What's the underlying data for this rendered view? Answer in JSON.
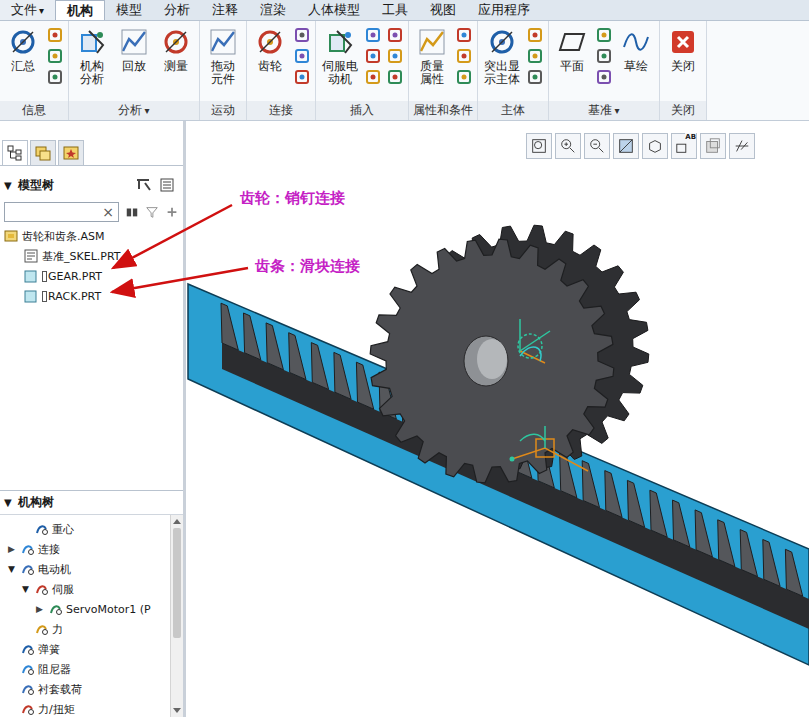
{
  "menu_bar": {
    "tabs": [
      {
        "label": "文件",
        "caret": "▾",
        "selected": false
      },
      {
        "label": "机构",
        "caret": "",
        "selected": true
      },
      {
        "label": "模型",
        "caret": "",
        "selected": false
      },
      {
        "label": "分析",
        "caret": "",
        "selected": false
      },
      {
        "label": "注释",
        "caret": "",
        "selected": false
      },
      {
        "label": "渲染",
        "caret": "",
        "selected": false
      },
      {
        "label": "人体模型",
        "caret": "",
        "selected": false
      },
      {
        "label": "工具",
        "caret": "",
        "selected": false
      },
      {
        "label": "视图",
        "caret": "",
        "selected": false
      },
      {
        "label": "应用程序",
        "caret": "",
        "selected": false
      }
    ]
  },
  "ribbon": {
    "groups": [
      {
        "label": "信息",
        "caret": "",
        "buttons": [
          {
            "lines": [
              "汇总"
            ]
          }
        ]
      },
      {
        "label": "分析",
        "caret": "▾",
        "buttons": [
          {
            "lines": [
              "机构",
              "分析"
            ]
          },
          {
            "lines": [
              "回放"
            ]
          },
          {
            "lines": [
              "测量"
            ]
          }
        ]
      },
      {
        "label": "运动",
        "caret": "",
        "buttons": [
          {
            "lines": [
              "拖动",
              "元件"
            ]
          }
        ]
      },
      {
        "label": "连接",
        "caret": "",
        "buttons": [
          {
            "lines": [
              "齿轮"
            ]
          }
        ]
      },
      {
        "label": "插入",
        "caret": "",
        "buttons": [
          {
            "lines": [
              "伺服电",
              "动机"
            ]
          }
        ]
      },
      {
        "label": "属性和条件",
        "caret": "",
        "buttons": [
          {
            "lines": [
              "质量",
              "属性"
            ]
          }
        ]
      },
      {
        "label": "主体",
        "caret": "",
        "buttons": [
          {
            "lines": [
              "突出显",
              "示主体"
            ]
          }
        ]
      },
      {
        "label": "基准",
        "caret": "▾",
        "buttons": [
          {
            "lines": [
              "平面"
            ]
          },
          {
            "lines": [
              "草绘"
            ]
          }
        ]
      },
      {
        "label": "关闭",
        "caret": "",
        "buttons": [
          {
            "lines": [
              "关闭"
            ]
          }
        ]
      }
    ]
  },
  "view_toolbar": {
    "badge": "AB"
  },
  "model_tree": {
    "title": "模型树",
    "toggle": "▼",
    "search": {
      "value": "",
      "clear": "×"
    },
    "items": [
      {
        "label": "齿轮和齿条.ASM",
        "depth": 0,
        "kind": "assembly"
      },
      {
        "label": "基准_SKEL.PRT",
        "depth": 1,
        "kind": "skeleton"
      },
      {
        "label": "GEAR.PRT",
        "depth": 1,
        "kind": "part"
      },
      {
        "label": "RACK.PRT",
        "depth": 1,
        "kind": "part"
      }
    ]
  },
  "mechanism_tree": {
    "title": "机构树",
    "toggle": "▼",
    "items": [
      {
        "label": "重心",
        "depth": 1,
        "toggle": "",
        "expanded": false
      },
      {
        "label": "连接",
        "depth": 0,
        "toggle": "▶",
        "expanded": false
      },
      {
        "label": "电动机",
        "depth": 0,
        "toggle": "▼",
        "expanded": true
      },
      {
        "label": "伺服",
        "depth": 1,
        "toggle": "▼",
        "expanded": true
      },
      {
        "label": "ServoMotor1 (P",
        "depth": 2,
        "toggle": "▶",
        "expanded": false
      },
      {
        "label": "力",
        "depth": 1,
        "toggle": "",
        "expanded": false
      },
      {
        "label": "弹簧",
        "depth": 0,
        "toggle": "",
        "expanded": false
      },
      {
        "label": "阻尼器",
        "depth": 0,
        "toggle": "",
        "expanded": false
      },
      {
        "label": "衬套载荷",
        "depth": 0,
        "toggle": "",
        "expanded": false
      },
      {
        "label": "力/扭矩",
        "depth": 0,
        "toggle": "",
        "expanded": false
      }
    ]
  },
  "annotations": [
    {
      "text": "齿轮：销钉连接"
    },
    {
      "text": "齿条：滑块连接"
    }
  ]
}
